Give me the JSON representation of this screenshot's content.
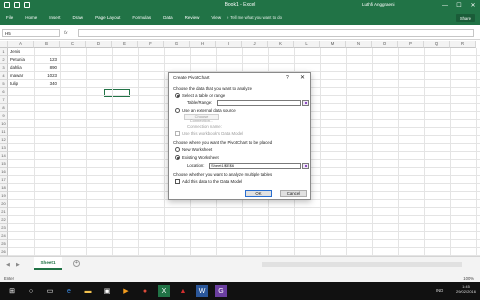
{
  "window": {
    "title": "Book1 - Excel",
    "user": "Luthfi Anggraeni",
    "controls": [
      "—",
      "☐",
      "✕"
    ]
  },
  "ribbon": {
    "tabs": [
      "File",
      "Home",
      "Insert",
      "Draw",
      "Page Layout",
      "Formulas",
      "Data",
      "Review",
      "View"
    ],
    "tell_me": "♀ Tell me what you want to do",
    "share": "Share"
  },
  "formula_bar": {
    "name_box": "H5",
    "fx": "fx",
    "value": ""
  },
  "grid": {
    "columns": [
      "A",
      "B",
      "C",
      "D",
      "E",
      "F",
      "G",
      "H",
      "I",
      "J",
      "K",
      "L",
      "M",
      "N",
      "O",
      "P",
      "Q",
      "R"
    ],
    "rows": [
      "1",
      "2",
      "3",
      "4",
      "5",
      "6",
      "7",
      "8",
      "9",
      "10",
      "11",
      "12",
      "13",
      "14",
      "15",
      "16",
      "17",
      "18",
      "19",
      "20",
      "21",
      "22",
      "23",
      "24",
      "25",
      "26"
    ],
    "data": [
      {
        "a": "Jenis",
        "b": ""
      },
      {
        "a": "Petunia",
        "b": "123"
      },
      {
        "a": "dahlia",
        "b": "890"
      },
      {
        "a": "mawar",
        "b": "1023"
      },
      {
        "a": "tulip",
        "b": "340"
      }
    ]
  },
  "sheets": {
    "active": "Sheet1",
    "add": "+"
  },
  "status": {
    "left": "Enter",
    "zoom": "100%"
  },
  "dialog": {
    "title": "Create PivotChart",
    "help": "?",
    "close": "✕",
    "section1": "Choose the data that you want to analyze",
    "opt_select_table": "Select a table or range",
    "table_range_label": "Table/Range:",
    "table_range_value": "",
    "opt_external": "Use an external data source",
    "choose_connection": "Choose Connection...",
    "connection_name": "Connection name:",
    "use_data_model": "Use this workbook's Data Model",
    "section2": "Choose where you want the PivotChart to be placed",
    "opt_new_ws": "New Worksheet",
    "opt_existing_ws": "Existing Worksheet",
    "location_label": "Location:",
    "location_value": "Sheet1!$E$6",
    "section3": "Choose whether you want to analyze multiple tables",
    "add_to_model": "Add this data to the Data Model",
    "ok": "OK",
    "cancel": "Cancel"
  },
  "taskbar": {
    "lang": "IND",
    "time": "1:45",
    "date": "29/02/2016",
    "icons": [
      "windows-start-icon",
      "search-icon",
      "task-view-icon",
      "edge-browser-icon",
      "file-explorer-icon",
      "store-icon",
      "media-icon",
      "chrome-icon",
      "excel-icon",
      "acrobat-icon",
      "word-icon",
      "app-icon"
    ]
  },
  "colors": {
    "excel_green": "#217346",
    "taskbar": "#111111"
  }
}
